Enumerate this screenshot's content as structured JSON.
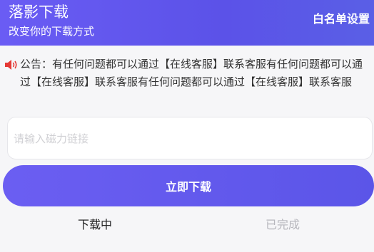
{
  "header": {
    "title": "落影下载",
    "subtitle": "改变你的下载方式",
    "whitelist_label": "白名单设置"
  },
  "notice": {
    "icon": "speaker-icon",
    "icon_color": "#e53935",
    "text": "公告：有任何问题都可以通过【在线客服】联系客服有任何问题都可以通过【在线客服】联系客服有任何问题都可以通过【在线客服】联系客服"
  },
  "magnet_input": {
    "placeholder": "请输入磁力链接",
    "value": ""
  },
  "download_button": {
    "label": "立即下载"
  },
  "tabs": [
    {
      "label": "下载中",
      "active": true
    },
    {
      "label": "已完成",
      "active": false
    }
  ],
  "colors": {
    "accent": "#5b55e8",
    "background": "#f6f6f8"
  }
}
